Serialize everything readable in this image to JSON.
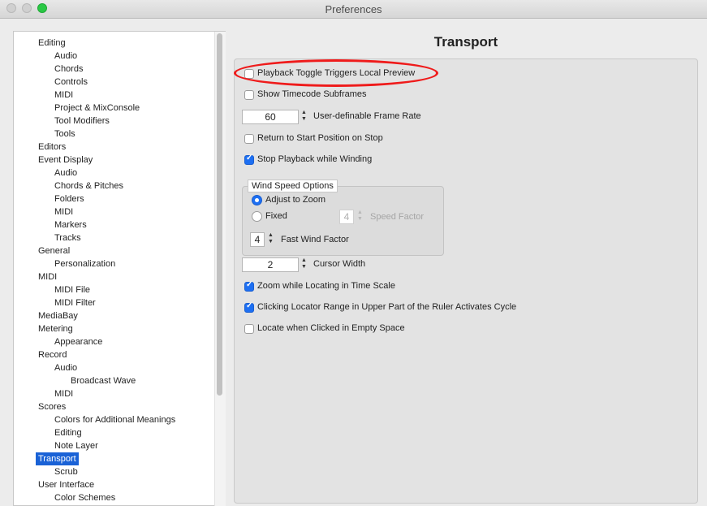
{
  "window": {
    "title": "Preferences"
  },
  "tree": [
    {
      "label": "Editing",
      "level": 0
    },
    {
      "label": "Audio",
      "level": 1
    },
    {
      "label": "Chords",
      "level": 1
    },
    {
      "label": "Controls",
      "level": 1
    },
    {
      "label": "MIDI",
      "level": 1
    },
    {
      "label": "Project & MixConsole",
      "level": 1
    },
    {
      "label": "Tool Modifiers",
      "level": 1
    },
    {
      "label": "Tools",
      "level": 1
    },
    {
      "label": "Editors",
      "level": 0
    },
    {
      "label": "Event Display",
      "level": 0
    },
    {
      "label": "Audio",
      "level": 1
    },
    {
      "label": "Chords & Pitches",
      "level": 1
    },
    {
      "label": "Folders",
      "level": 1
    },
    {
      "label": "MIDI",
      "level": 1
    },
    {
      "label": "Markers",
      "level": 1
    },
    {
      "label": "Tracks",
      "level": 1
    },
    {
      "label": "General",
      "level": 0
    },
    {
      "label": "Personalization",
      "level": 1
    },
    {
      "label": "MIDI",
      "level": 0
    },
    {
      "label": "MIDI File",
      "level": 1
    },
    {
      "label": "MIDI Filter",
      "level": 1
    },
    {
      "label": "MediaBay",
      "level": 0
    },
    {
      "label": "Metering",
      "level": 0
    },
    {
      "label": "Appearance",
      "level": 1
    },
    {
      "label": "Record",
      "level": 0
    },
    {
      "label": "Audio",
      "level": 1
    },
    {
      "label": "Broadcast Wave",
      "level": 2
    },
    {
      "label": "MIDI",
      "level": 1
    },
    {
      "label": "Scores",
      "level": 0
    },
    {
      "label": "Colors for Additional Meanings",
      "level": 1
    },
    {
      "label": "Editing",
      "level": 1
    },
    {
      "label": "Note Layer",
      "level": 1
    },
    {
      "label": "Transport",
      "level": 0,
      "selected": true
    },
    {
      "label": "Scrub",
      "level": 1
    },
    {
      "label": "User Interface",
      "level": 0
    },
    {
      "label": "Color Schemes",
      "level": 1
    }
  ],
  "panel": {
    "title": "Transport",
    "playback_toggle": {
      "label": "Playback Toggle Triggers Local Preview",
      "checked": false
    },
    "show_timecode": {
      "label": "Show Timecode Subframes",
      "checked": false
    },
    "frame_rate": {
      "value": "60",
      "label": "User-definable Frame Rate"
    },
    "return_to_start": {
      "label": "Return to Start Position on Stop",
      "checked": false
    },
    "stop_playback": {
      "label": "Stop Playback while Winding",
      "checked": true
    },
    "wind_speed": {
      "title": "Wind Speed Options",
      "adjust_to_zoom": {
        "label": "Adjust to Zoom",
        "selected": true
      },
      "fixed": {
        "label": "Fixed",
        "selected": false
      },
      "speed_factor": {
        "value": "4",
        "label": "Speed Factor"
      },
      "fast_wind": {
        "value": "4",
        "label": "Fast Wind Factor"
      }
    },
    "cursor_width": {
      "value": "2",
      "label": "Cursor Width"
    },
    "zoom_locating": {
      "label": "Zoom while Locating in Time Scale",
      "checked": true
    },
    "clicking_locator": {
      "label": "Clicking Locator Range in Upper Part of the Ruler Activates Cycle",
      "checked": true
    },
    "locate_empty": {
      "label": "Locate when Clicked in Empty Space",
      "checked": false
    }
  },
  "colors": {
    "accent": "#1d6ff2",
    "selection": "#1a62d6",
    "highlight_ring": "#ef1b1b"
  }
}
